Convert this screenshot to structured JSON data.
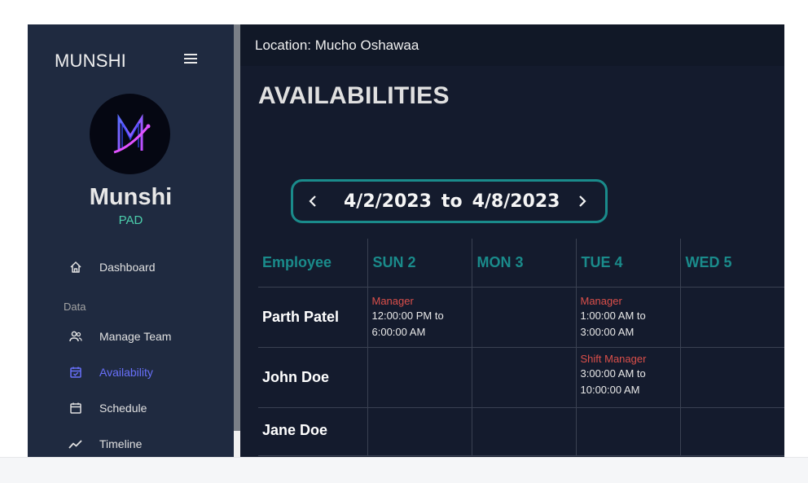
{
  "sidebar": {
    "brand": "MUNSHI",
    "profile_name": "Munshi",
    "profile_role": "PAD",
    "section_data": "Data",
    "items": [
      {
        "label": "Dashboard",
        "icon": "home-icon",
        "active": false
      },
      {
        "label": "Manage Team",
        "icon": "people-icon",
        "active": false
      },
      {
        "label": "Availability",
        "icon": "calendar-check-icon",
        "active": true
      },
      {
        "label": "Schedule",
        "icon": "calendar-icon",
        "active": false
      },
      {
        "label": "Timeline",
        "icon": "timeline-icon",
        "active": false
      }
    ]
  },
  "header": {
    "location": "Location: Mucho Oshawaa"
  },
  "main": {
    "title": "AVAILABILITIES",
    "range_start": "4/2/2023",
    "range_to": "to",
    "range_end": "4/8/2023",
    "table": {
      "columns": [
        "Employee",
        "SUN 2",
        "MON 3",
        "TUE 4",
        "WED 5"
      ],
      "rows": [
        {
          "employee": "Parth Patel",
          "cells": [
            {
              "role": "Manager",
              "time1": "12:00:00 PM to",
              "time2": "6:00:00 AM"
            },
            {
              "role": "",
              "time1": "",
              "time2": ""
            },
            {
              "role": "Manager",
              "time1": "1:00:00 AM to",
              "time2": "3:00:00 AM"
            },
            {
              "role": "",
              "time1": "",
              "time2": ""
            }
          ]
        },
        {
          "employee": "John Doe",
          "cells": [
            {
              "role": "",
              "time1": "",
              "time2": ""
            },
            {
              "role": "",
              "time1": "",
              "time2": ""
            },
            {
              "role": "Shift Manager",
              "time1": "3:00:00 AM to",
              "time2": "10:00:00 AM"
            },
            {
              "role": "",
              "time1": "",
              "time2": ""
            }
          ]
        },
        {
          "employee": "Jane Doe",
          "cells": [
            {
              "role": "",
              "time1": "",
              "time2": ""
            },
            {
              "role": "",
              "time1": "",
              "time2": ""
            },
            {
              "role": "",
              "time1": "",
              "time2": ""
            },
            {
              "role": "",
              "time1": "",
              "time2": ""
            }
          ]
        }
      ]
    }
  },
  "colors": {
    "sidebar_bg": "#1f2a40",
    "main_bg": "#141b2d",
    "accent_teal": "#1a8b8b",
    "active_nav": "#6870fa",
    "role_red": "#db4f4a",
    "profile_role_green": "#4cceac"
  }
}
